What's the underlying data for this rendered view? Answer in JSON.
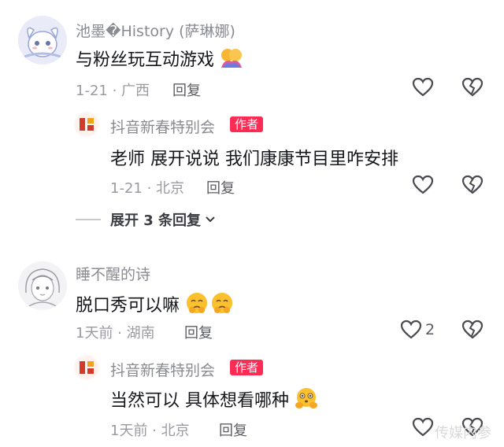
{
  "comments": [
    {
      "author": "池墨�History (萨琳娜)",
      "text": "与粉丝玩互动游戏",
      "emoji": "hug-emoji",
      "meta": "1-21 · 广西",
      "reply_label": "回复",
      "like_count": "",
      "replies": [
        {
          "author": "抖音新春特别会",
          "badge": "作者",
          "text": "老师 展开说说 我们康康节目里咋安排",
          "meta": "1-21 · 北京",
          "reply_label": "回复"
        }
      ],
      "expand_label": "展开 3 条回复"
    },
    {
      "author": "睡不醒的诗",
      "text": "脱口秀可以嘛",
      "emoji": "pleading-face-emoji",
      "meta": "1天前 · 湖南",
      "reply_label": "回复",
      "like_count": "2",
      "replies": [
        {
          "author": "抖音新春特别会",
          "badge": "作者",
          "text": "当然可以 具体想看哪种",
          "emoji": "hugging-face-emoji",
          "meta": "1天前 · 北京",
          "reply_label": "回复"
        }
      ]
    }
  ],
  "watermark": "传媒内参",
  "colors": {
    "badge": "#fe2c55",
    "text_primary": "#16171b",
    "text_secondary": "#9a9ba1"
  }
}
